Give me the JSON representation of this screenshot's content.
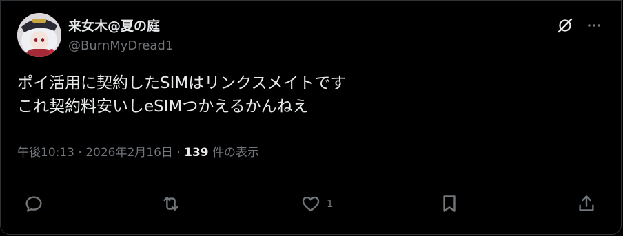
{
  "user": {
    "display_name": "来女木@夏の庭",
    "handle": "@BurnMyDread1",
    "avatar_icon": "avatar-anime-character"
  },
  "top_actions": {
    "grok_icon": "grok-icon",
    "more_icon": "more-options-icon"
  },
  "tweet": {
    "lines": [
      "ポイ活用に契約したSIMはリンクスメイトです",
      "これ契約料安いしeSIMつかえるかんねえ"
    ]
  },
  "meta": {
    "timestamp": "午後10:13 · 2026年2月16日 · ",
    "views_count": "139",
    "views_label": " 件の表示"
  },
  "actions": {
    "reply_icon": "reply-icon",
    "retweet_icon": "retweet-icon",
    "like_icon": "like-icon",
    "like_count": "1",
    "bookmark_icon": "bookmark-icon",
    "share_icon": "share-icon"
  },
  "colors": {
    "background": "#000000",
    "text_primary": "#e7e9ea",
    "text_secondary": "#71767b",
    "border": "#2f3336"
  }
}
